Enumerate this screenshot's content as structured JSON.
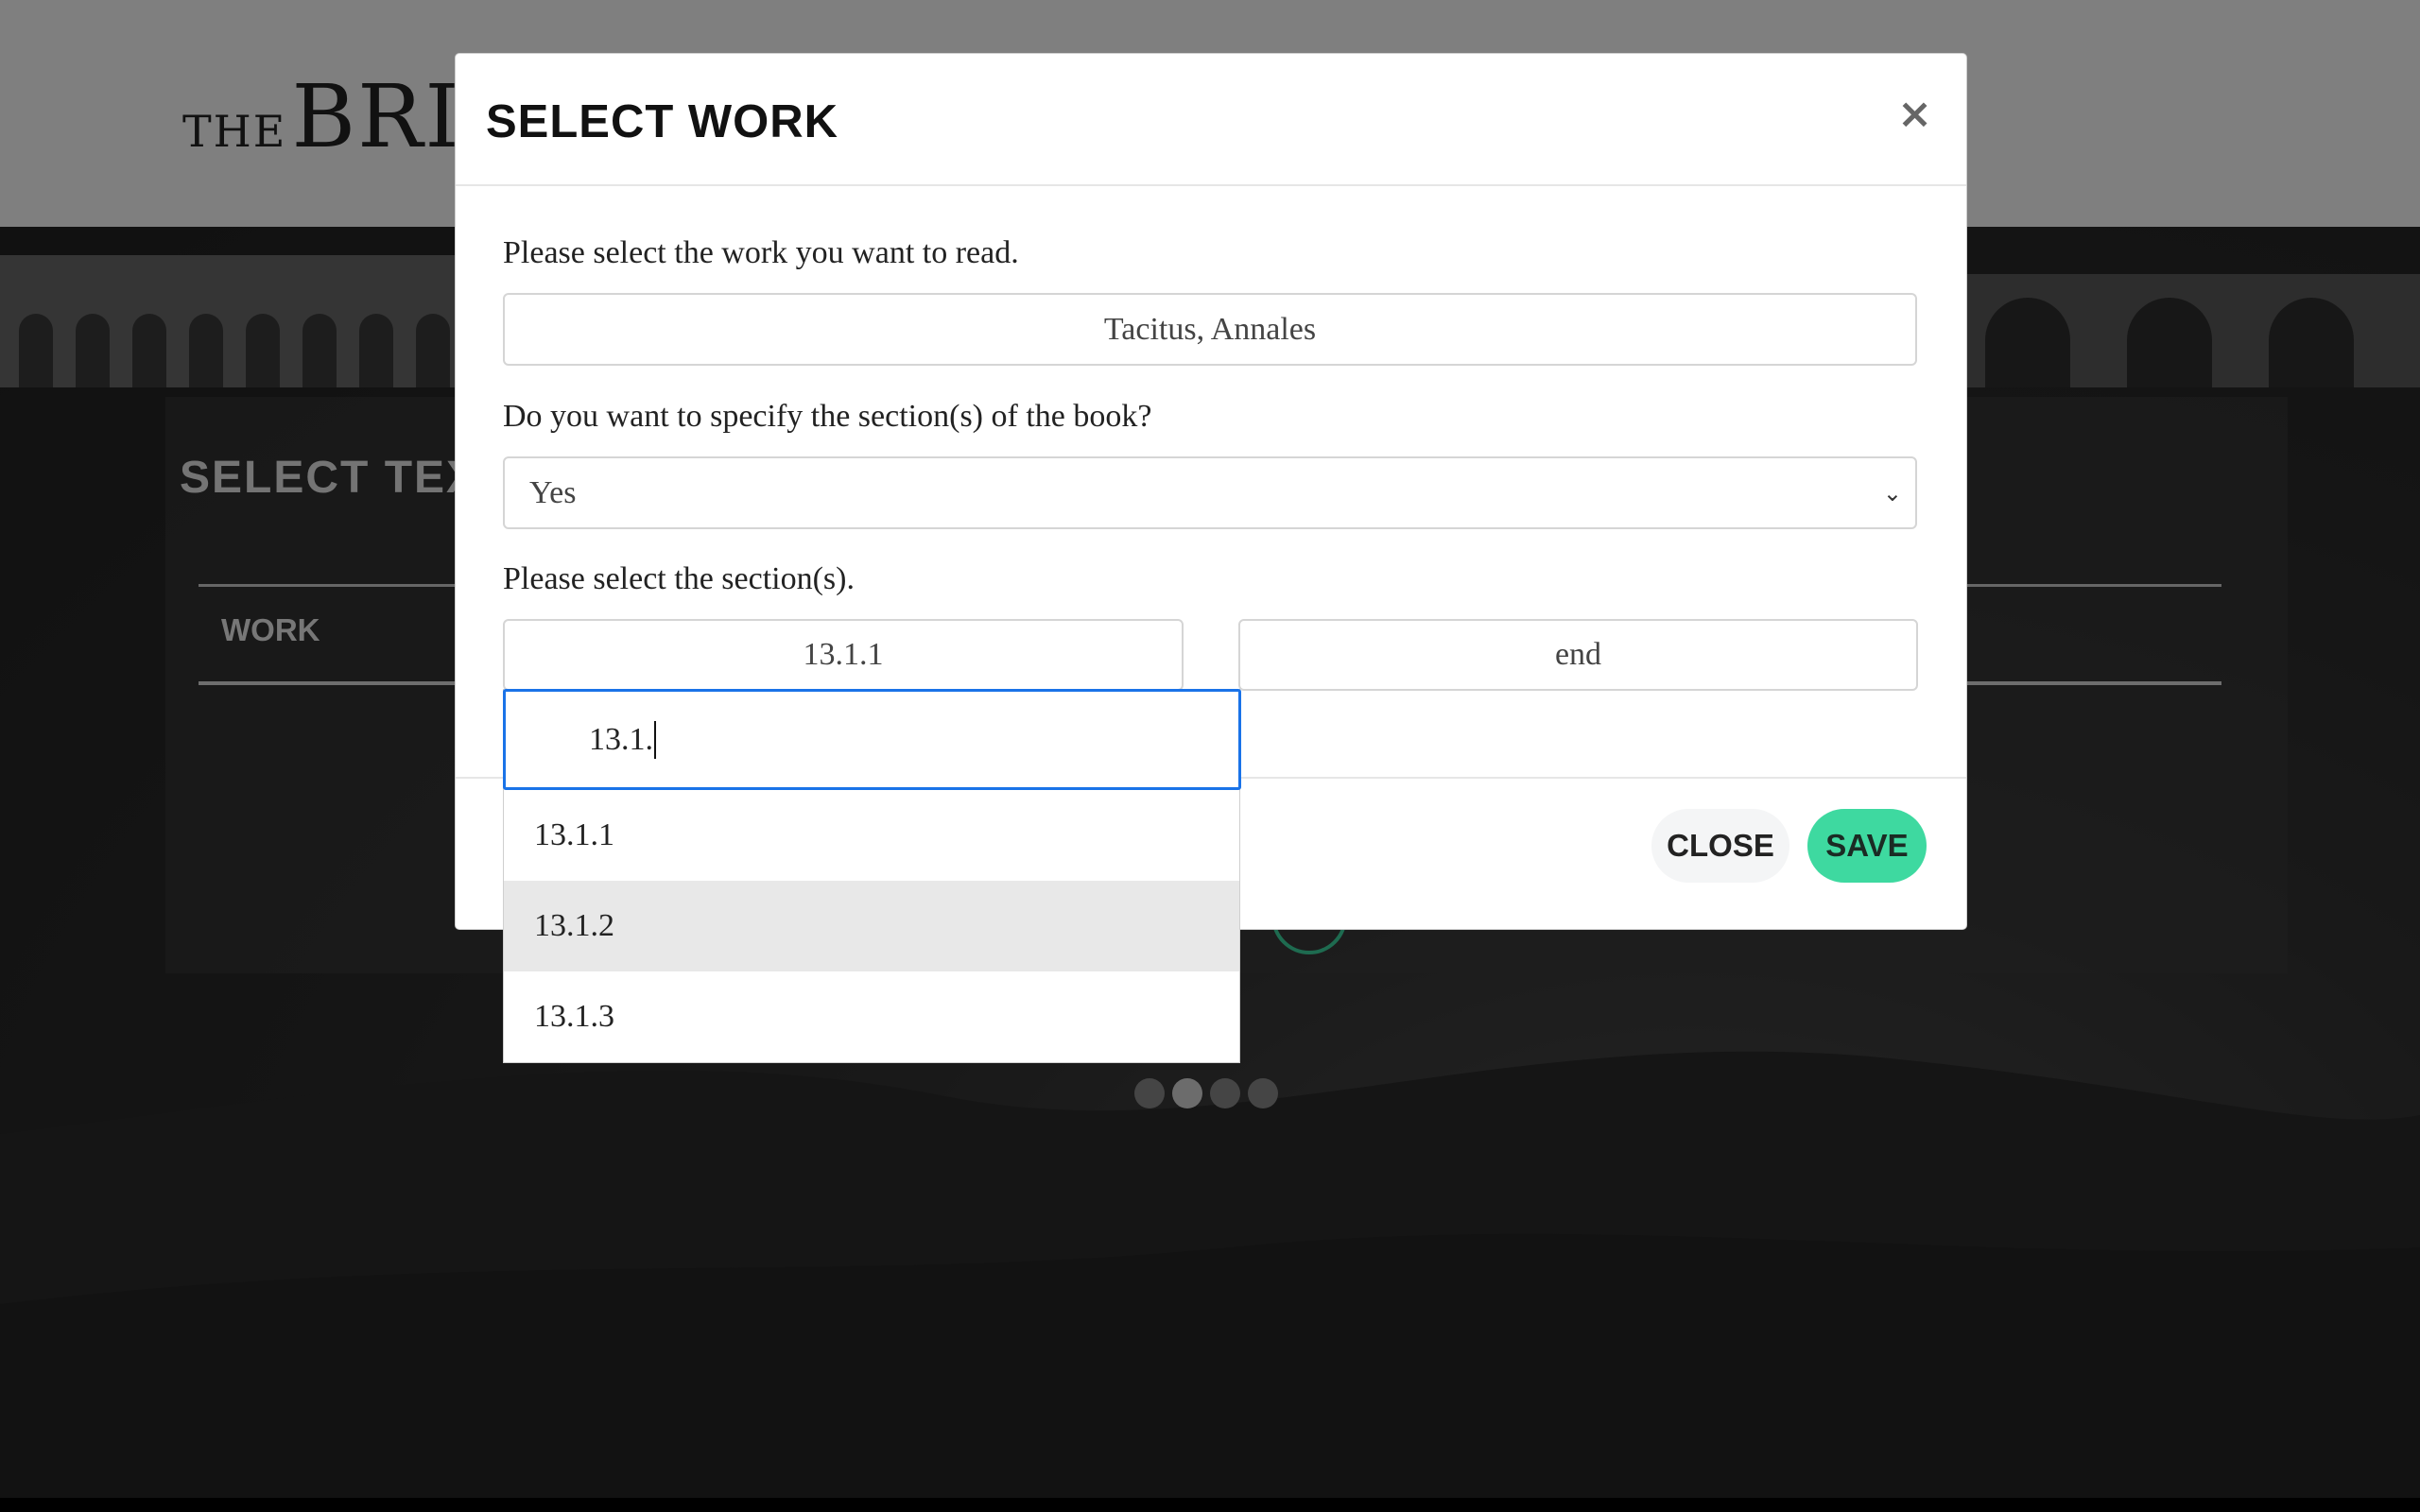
{
  "background": {
    "logo_small": "THE",
    "logo_big": "BRII",
    "section_title": "SELECT TEXT",
    "work_label": "WORK"
  },
  "modal": {
    "title": "SELECT WORK",
    "close_symbol": "×",
    "work_prompt": "Please select the work you want to read.",
    "work_value": "Tacitus, Annales",
    "section_prompt": "Do you want to specify the section(s) of the book?",
    "section_choice": "Yes",
    "range_prompt": "Please select the section(s).",
    "range_start": "13.1.1",
    "range_end": "end",
    "buttons": {
      "close": "CLOSE",
      "save": "SAVE"
    }
  },
  "dropdown": {
    "search_value": "13.1.",
    "options": [
      "13.1.1",
      "13.1.2",
      "13.1.3"
    ],
    "hovered_option": "13.1.2"
  },
  "carousel": {
    "dot_count": 4,
    "active_dot": 2
  },
  "colors": {
    "accent": "#3ed9a0",
    "focus": "#1a73e8"
  }
}
